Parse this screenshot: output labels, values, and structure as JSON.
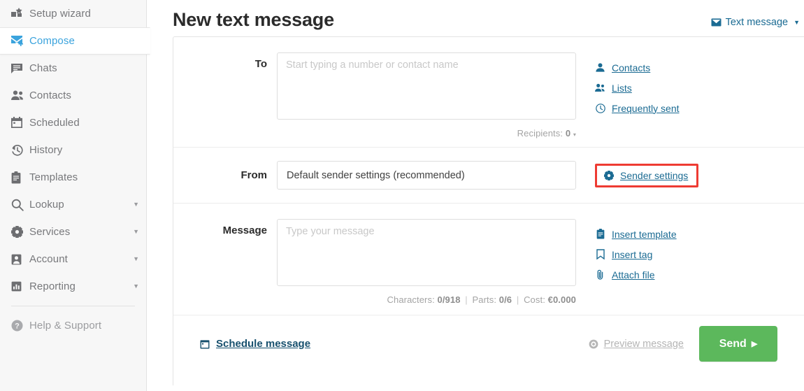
{
  "sidebar": {
    "items": [
      {
        "label": "Setup wizard",
        "icon": "setup-wizard-icon",
        "active": false,
        "caret": false
      },
      {
        "label": "Compose",
        "icon": "compose-icon",
        "active": true,
        "caret": false
      },
      {
        "label": "Chats",
        "icon": "chats-icon",
        "active": false,
        "caret": false
      },
      {
        "label": "Contacts",
        "icon": "contacts-icon",
        "active": false,
        "caret": false
      },
      {
        "label": "Scheduled",
        "icon": "calendar-icon",
        "active": false,
        "caret": false
      },
      {
        "label": "History",
        "icon": "history-icon",
        "active": false,
        "caret": false
      },
      {
        "label": "Templates",
        "icon": "templates-icon",
        "active": false,
        "caret": false
      },
      {
        "label": "Lookup",
        "icon": "search-icon",
        "active": false,
        "caret": true
      },
      {
        "label": "Services",
        "icon": "gear-icon",
        "active": false,
        "caret": true
      },
      {
        "label": "Account",
        "icon": "user-icon",
        "active": false,
        "caret": true
      },
      {
        "label": "Reporting",
        "icon": "bar-chart-icon",
        "active": false,
        "caret": true
      }
    ],
    "help": {
      "label": "Help & Support",
      "icon": "question-circle-icon"
    }
  },
  "header": {
    "title": "New text message",
    "message_type": "Text message"
  },
  "form": {
    "to": {
      "label": "To",
      "placeholder": "Start typing a number or contact name",
      "value": "",
      "meta_label": "Recipients:",
      "meta_value": "0",
      "links": [
        {
          "label": "Contacts",
          "icon": "contact-person-icon"
        },
        {
          "label": "Lists",
          "icon": "contact-list-icon"
        },
        {
          "label": "Frequently sent",
          "icon": "clock-icon"
        }
      ]
    },
    "from": {
      "label": "From",
      "selected": "Default sender settings (recommended)",
      "sender_settings_link": "Sender settings",
      "sender_settings_icon": "gear-icon",
      "highlight_color": "#ee3b33"
    },
    "message": {
      "label": "Message",
      "placeholder": "Type your message",
      "value": "",
      "counters": {
        "characters_label": "Characters:",
        "characters_value": "0/918",
        "parts_label": "Parts:",
        "parts_value": "0/6",
        "cost_label": "Cost:",
        "cost_value": "€0.000"
      },
      "links": [
        {
          "label": "Insert template",
          "icon": "clipboard-icon"
        },
        {
          "label": "Insert tag",
          "icon": "bookmark-icon"
        },
        {
          "label": "Attach file",
          "icon": "paperclip-icon"
        }
      ]
    }
  },
  "footer": {
    "schedule_label": "Schedule message",
    "schedule_icon": "calendar-icon",
    "preview_label": "Preview message",
    "preview_icon": "eye-icon",
    "send_label": "Send",
    "send_color": "#5cb85c"
  }
}
